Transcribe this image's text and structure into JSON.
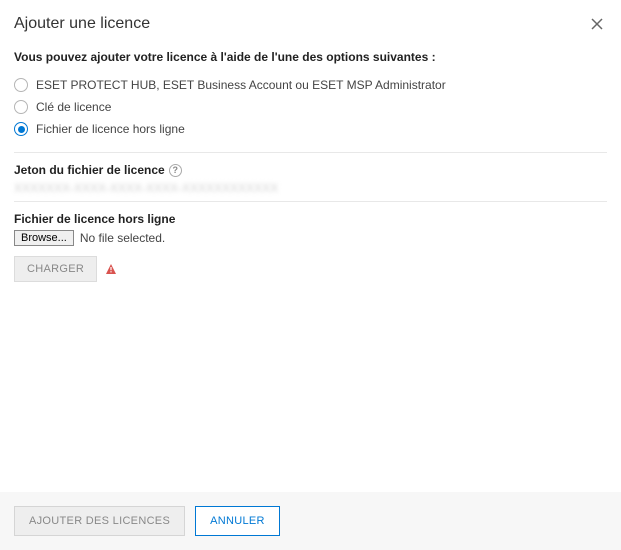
{
  "header": {
    "title": "Ajouter une licence"
  },
  "intro": "Vous pouvez ajouter votre licence à l'aide de l'une des options suivantes :",
  "options": [
    {
      "label": "ESET PROTECT HUB, ESET Business Account ou ESET MSP Administrator",
      "selected": false
    },
    {
      "label": "Clé de licence",
      "selected": false
    },
    {
      "label": "Fichier de licence hors ligne",
      "selected": true
    }
  ],
  "token": {
    "label": "Jeton du fichier de licence",
    "value": "XXXXXXX-XXXX-XXXX-XXXX-XXXXXXXXXXXX"
  },
  "file": {
    "label": "Fichier de licence hors ligne",
    "browse": "Browse...",
    "status": "No file selected.",
    "upload": "CHARGER"
  },
  "footer": {
    "add": "AJOUTER DES LICENCES",
    "cancel": "ANNULER"
  }
}
